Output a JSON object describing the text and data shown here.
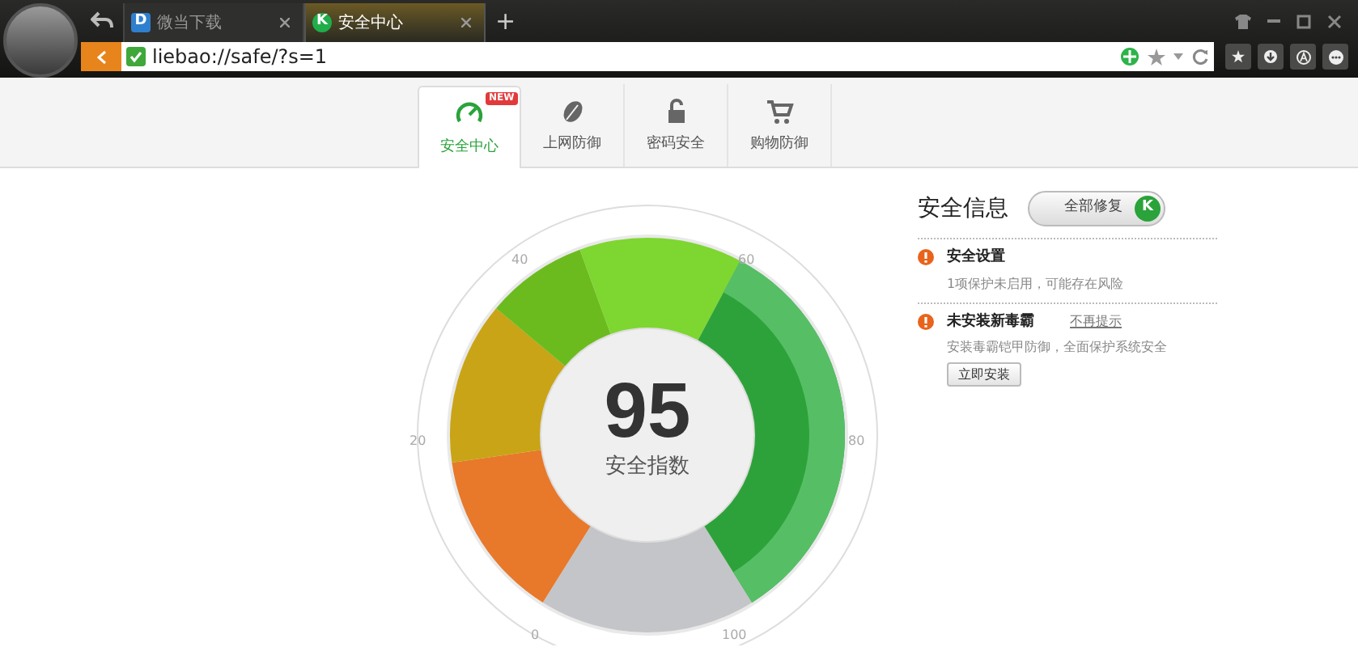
{
  "browser_tabs": [
    {
      "label": "微当下载",
      "icon": "D",
      "selected": false
    },
    {
      "label": "安全中心",
      "icon": "K",
      "selected": true
    }
  ],
  "new_tab": "+",
  "address_bar": {
    "value": "liebao://safe/?s=1"
  },
  "nav_tabs": [
    {
      "label": "安全中心",
      "selected": true,
      "badge": "NEW"
    },
    {
      "label": "上网防御",
      "selected": false
    },
    {
      "label": "密码安全",
      "selected": false
    },
    {
      "label": "购物防御",
      "selected": false
    }
  ],
  "gauge": {
    "score": "95",
    "caption": "安全指数",
    "ticks": [
      "0",
      "20",
      "40",
      "60",
      "80",
      "100"
    ]
  },
  "info_panel": {
    "title": "安全信息",
    "fix_all_button": "全部修复",
    "fix_all_badge": "K",
    "items": [
      {
        "title": "安全设置",
        "description": "1项保护未启用，可能存在风险"
      },
      {
        "title": "未安装新毒霸",
        "link": "不再提示",
        "description": "安装毒霸铠甲防御，全面保护系统安全",
        "button": "立即安装"
      }
    ]
  }
}
